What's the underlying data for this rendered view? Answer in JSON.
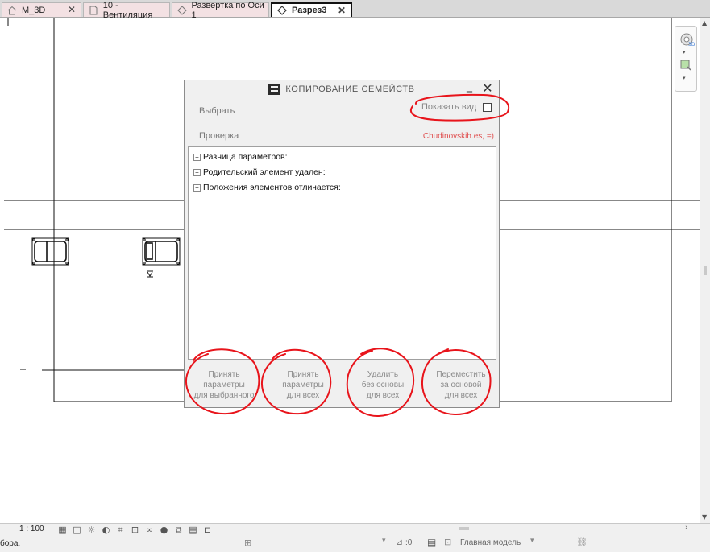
{
  "tabs": [
    {
      "label": "M_3D",
      "icon": "home-icon",
      "active": false
    },
    {
      "label": "10 - Вентиляция",
      "icon": "floor-plan-icon",
      "active": false
    },
    {
      "label": "Развертка по Оси 1",
      "icon": "elevation-icon",
      "active": false
    },
    {
      "label": "Разрез3",
      "icon": "section-icon",
      "active": true
    }
  ],
  "tab_close": "✕",
  "dialog": {
    "title": "КОПИРОВАНИЕ СЕМЕЙСТВ",
    "minimize": "_",
    "close": "✕",
    "choose_label": "Выбрать",
    "check_label": "Проверка",
    "show_view_label": "Показать вид",
    "show_view_checked": false,
    "user": "Chudinovskih.es, =)",
    "tree_items": [
      {
        "label": "Разница параметров:"
      },
      {
        "label": "Родительский элемент удален:"
      },
      {
        "label": "Положения элементов отличается:"
      }
    ],
    "expander": "⊞",
    "buttons": [
      {
        "line1": "Принять",
        "line2": "параметры",
        "line3": "для выбранного"
      },
      {
        "line1": "Принять",
        "line2": "параметры",
        "line3": "для всех"
      },
      {
        "line1": "Удалить",
        "line2": "без основы",
        "line3": "для всех"
      },
      {
        "line1": "Переместить",
        "line2": "за основой",
        "line3": "для всех"
      }
    ]
  },
  "statusbar": {
    "scale": "1 : 100",
    "status_text": "бора.",
    "selection_count": ":0",
    "model": "Главная модель"
  },
  "colors": {
    "annotation": "#e8141b",
    "user_tag": "#e05050"
  }
}
